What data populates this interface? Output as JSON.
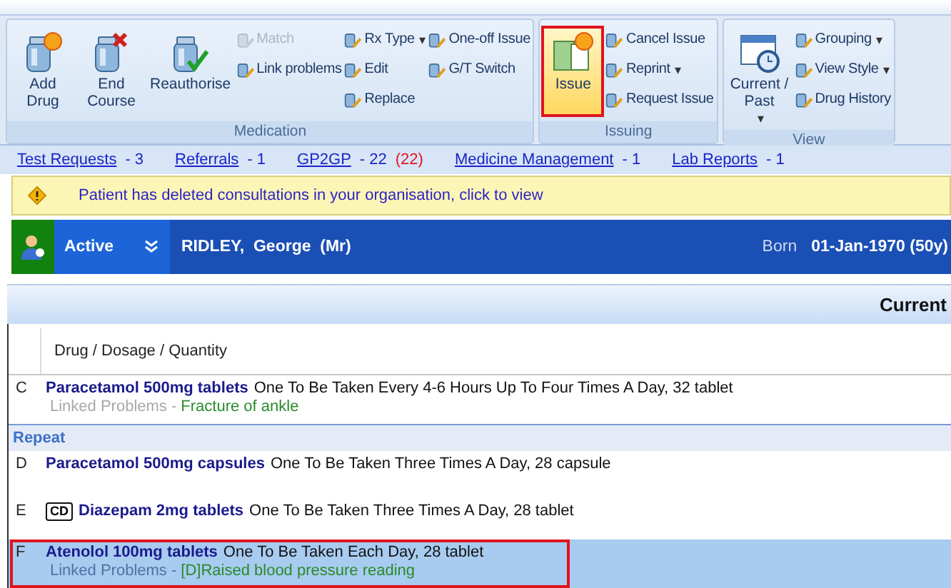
{
  "ribbon": {
    "groups": [
      {
        "label": "Medication",
        "columns": [
          [
            {
              "label": "Add Drug",
              "kind": "large",
              "disabled": false,
              "active": false
            }
          ],
          [
            {
              "label": "End Course",
              "kind": "large",
              "disabled": false,
              "active": false
            }
          ],
          [
            {
              "label": "Reauthorise",
              "kind": "large",
              "disabled": false,
              "active": false
            }
          ],
          [
            {
              "label": "Match",
              "kind": "small",
              "disabled": true,
              "active": false
            },
            {
              "label": "Link problems",
              "kind": "small",
              "disabled": false,
              "active": false
            }
          ],
          [
            {
              "label": "Rx Type",
              "kind": "small",
              "disabled": false,
              "caret": "▾",
              "active": false
            },
            {
              "label": "Edit",
              "kind": "small",
              "disabled": false,
              "active": false
            },
            {
              "label": "Replace",
              "kind": "small",
              "disabled": false,
              "active": false
            }
          ],
          [
            {
              "label": "One-off Issue",
              "kind": "small",
              "disabled": false,
              "active": false
            },
            {
              "label": "G/T Switch",
              "kind": "small",
              "disabled": false,
              "active": false
            }
          ]
        ]
      },
      {
        "label": "Issuing",
        "columns": [
          [
            {
              "label": "Issue",
              "kind": "large",
              "disabled": false,
              "active": true
            }
          ],
          [
            {
              "label": "Cancel Issue",
              "kind": "small",
              "disabled": false,
              "active": false
            },
            {
              "label": "Reprint",
              "kind": "small",
              "disabled": false,
              "caret": "▾",
              "active": false
            },
            {
              "label": "Request Issue",
              "kind": "small",
              "disabled": false,
              "active": false
            }
          ]
        ]
      },
      {
        "label": "View",
        "columns": [
          [
            {
              "label": "Current / Past",
              "kind": "large",
              "disabled": false,
              "caret": "▾",
              "active": false
            }
          ],
          [
            {
              "label": "Grouping",
              "kind": "small",
              "disabled": false,
              "caret": "▾",
              "active": false
            },
            {
              "label": "View Style",
              "kind": "small",
              "disabled": false,
              "caret": "▾",
              "active": false
            },
            {
              "label": "Drug History",
              "kind": "small",
              "disabled": false,
              "active": false
            }
          ]
        ]
      }
    ]
  },
  "links": [
    {
      "label": "Test Requests",
      "count": "- 3"
    },
    {
      "label": "Referrals",
      "count": "- 1"
    },
    {
      "label": "GP2GP",
      "count": "- 22",
      "extra": "(22)"
    },
    {
      "label": "Medicine Management",
      "count": "- 1"
    },
    {
      "label": "Lab Reports",
      "count": "- 1"
    }
  ],
  "alert": "Patient has deleted consultations in your organisation, click to view",
  "patient": {
    "status": "Active",
    "name": "RIDLEY,  George  (Mr)",
    "born_label": "Born",
    "born": "01-Jan-1970 (50y)"
  },
  "view_title": "Current",
  "table": {
    "columns": [
      "Drug / Dosage / Quantity"
    ],
    "rows": [
      {
        "kind": "drug",
        "letter": "C",
        "name": "Paracetamol 500mg tablets",
        "dosage": "One To Be Taken Every 4-6 Hours Up To Four Times A Day, 32 tablet",
        "linked_label": "Linked Problems -",
        "linked": "Fracture of ankle",
        "cd": false,
        "selected": false,
        "highlighted": false
      },
      {
        "kind": "section",
        "label": "Repeat"
      },
      {
        "kind": "drug",
        "letter": "D",
        "name": "Paracetamol 500mg capsules",
        "dosage": "One To Be Taken Three Times A Day, 28 capsule",
        "cd": false,
        "selected": false,
        "highlighted": false
      },
      {
        "kind": "drug",
        "letter": "E",
        "badge": "CD",
        "name": "Diazepam 2mg tablets",
        "dosage": "One To Be Taken Three Times A Day, 28 tablet",
        "cd": true,
        "selected": false,
        "highlighted": false
      },
      {
        "kind": "drug",
        "letter": "F",
        "name": "Atenolol 100mg tablets",
        "dosage": "One To Be Taken Each Day, 28 tablet",
        "linked_label": "Linked Problems -",
        "linked": "[D]Raised blood pressure reading",
        "cd": false,
        "selected": true,
        "highlighted": true
      }
    ]
  }
}
